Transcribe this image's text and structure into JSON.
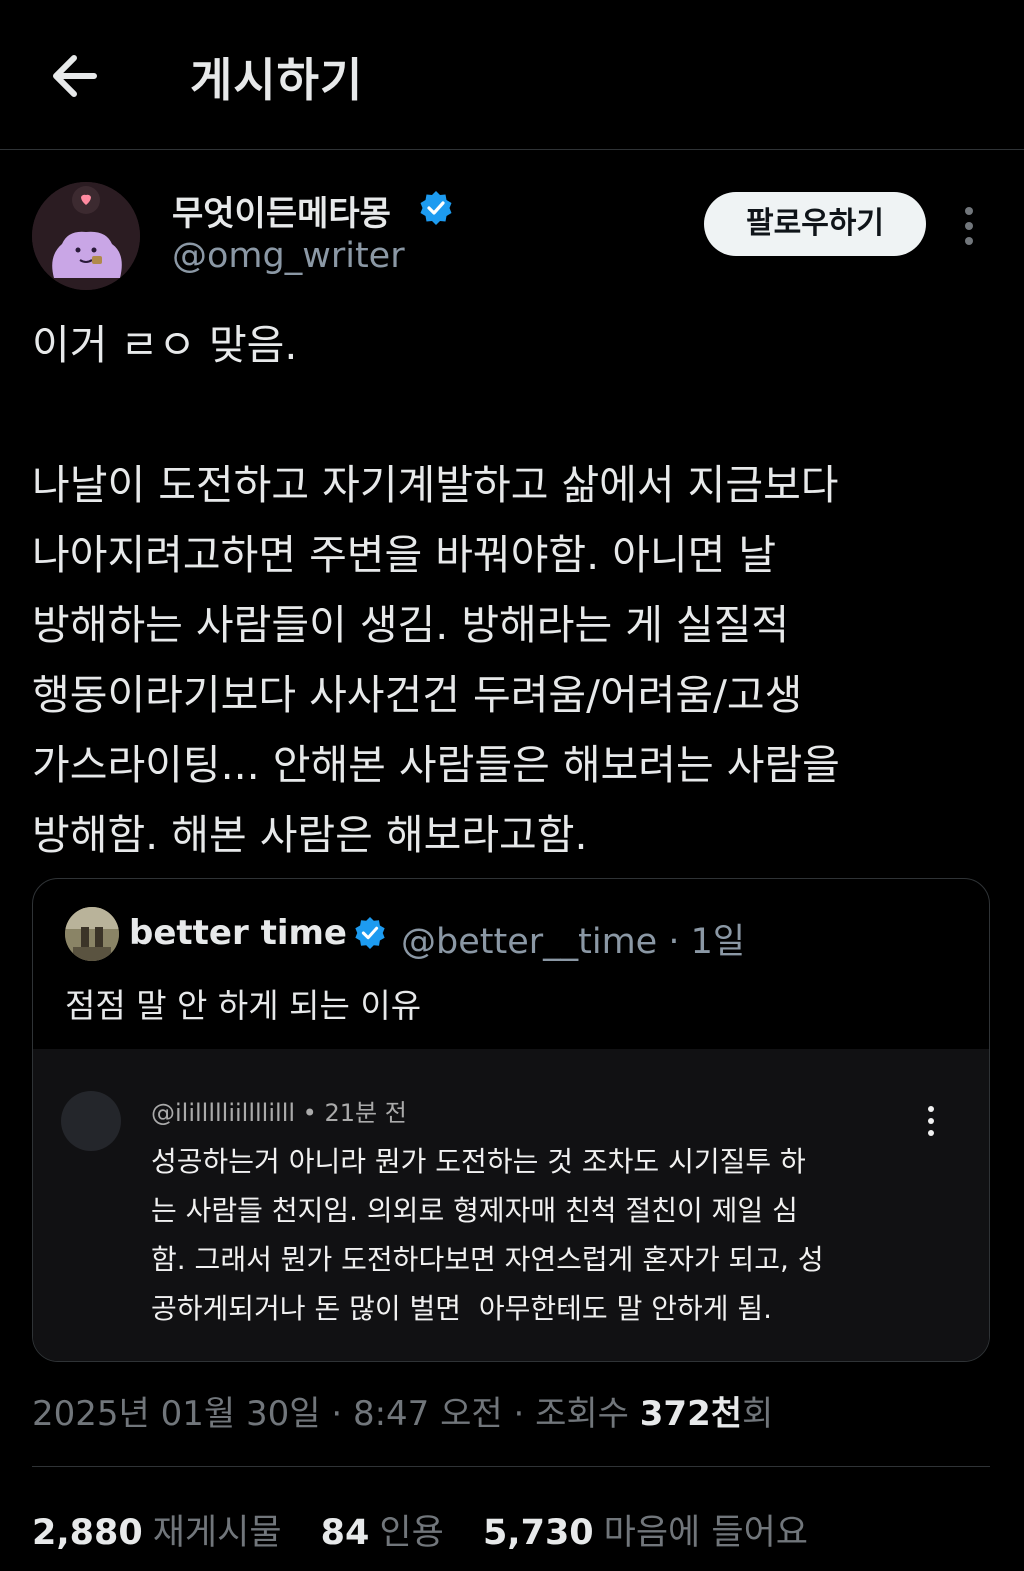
{
  "header": {
    "title": "게시하기",
    "back_icon": "arrow-left-icon"
  },
  "author": {
    "display_name": "무엇이든메타몽",
    "handle": "@omg_writer",
    "verified": true,
    "follow_label": "팔로우하기"
  },
  "post": {
    "text": "이거 ㄹㅇ 맞음.\n\n나날이 도전하고 자기계발하고 삶에서 지금보다\n나아지려고하면 주변을 바꿔야함. 아니면 날\n방해하는 사람들이 생김. 방해라는 게 실질적\n행동이라기보다 사사건건 두려움/어려움/고생\n가스라이팅... 안해본 사람들은 해보려는 사람을\n방해함. 해본 사람은 해보라고함."
  },
  "quote": {
    "name": "better time",
    "handle": "@better__time",
    "time": "1일",
    "text": "점점 말 안 하게 되는 이유",
    "embed": {
      "user": "@ilillllliillllilll",
      "time": "21분 전",
      "text": "성공하는거 아니라 뭔가 도전하는 것 조차도 시기질투 하\n는 사람들 천지임. 의외로 형제자매 친척 절친이 제일 심\n함. 그래서 뭔가 도전하다보면 자연스럽게 혼자가 되고, 성\n공하게되거나 돈 많이 벌면  아무한테도 말 안하게 됨."
    }
  },
  "meta": {
    "date": "2025년 01월 30일",
    "time": "8:47 오전",
    "views_label": "조회수",
    "views_value": "372천",
    "views_suffix": "회"
  },
  "stats": {
    "reposts": {
      "value": "2,880",
      "label": "재게시물"
    },
    "quotes": {
      "value": "84",
      "label": "인용"
    },
    "likes": {
      "value": "5,730",
      "label": "마음에 들어요"
    }
  },
  "colors": {
    "background": "#000000",
    "text": "#e7e9ea",
    "secondary": "#71767b",
    "verified_blue": "#1d9bf0",
    "follow_bg": "#eff3f4"
  }
}
